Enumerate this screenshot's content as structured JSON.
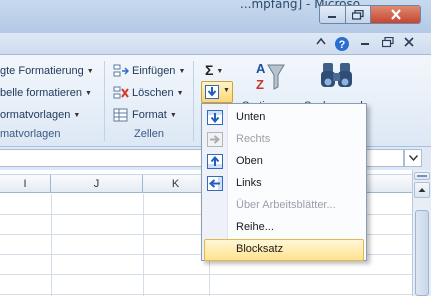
{
  "window": {
    "title_fragment": "...mpfang] - Microso..."
  },
  "ribbon": {
    "styles_group": {
      "items": [
        "gte Formatierung",
        "belle formatieren",
        "ormatvorlagen"
      ],
      "label": "matvorlagen"
    },
    "cells_group": {
      "items": [
        "Einfügen",
        "Löschen",
        "Format"
      ],
      "label": "Zellen"
    },
    "editing_group": {
      "sum_symbol": "Σ",
      "sort_label": "Sortieren",
      "find_label": "Suchen und"
    }
  },
  "sheet": {
    "columns": [
      "I",
      "J",
      "K"
    ]
  },
  "fill_menu": {
    "items": [
      {
        "label": "Unten",
        "enabled": true,
        "highlighted": false,
        "icon": "fill-down-icon"
      },
      {
        "label": "Rechts",
        "enabled": false,
        "highlighted": false,
        "icon": "fill-right-icon"
      },
      {
        "label": "Oben",
        "enabled": true,
        "highlighted": false,
        "icon": "fill-up-icon"
      },
      {
        "label": "Links",
        "enabled": true,
        "highlighted": false,
        "icon": "fill-left-icon"
      },
      {
        "label": "Über Arbeitsblätter...",
        "enabled": false,
        "highlighted": false,
        "icon": ""
      },
      {
        "label": "Reihe...",
        "enabled": true,
        "highlighted": false,
        "icon": ""
      },
      {
        "label": "Blocksatz",
        "enabled": true,
        "highlighted": true,
        "icon": ""
      }
    ]
  },
  "colors": {
    "accent_blue": "#3b7bd8",
    "highlight": "#ffe38e",
    "ribbon_bg": "#dde8f5"
  }
}
